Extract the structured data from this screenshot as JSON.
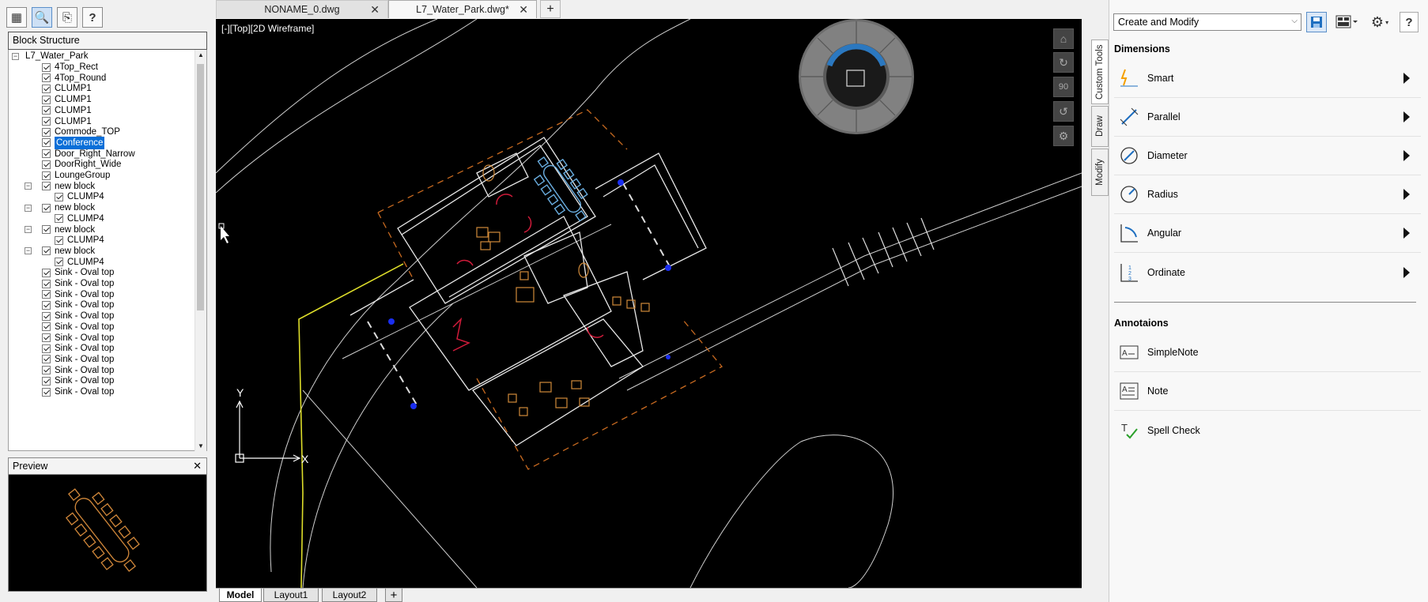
{
  "left_toolbar": {
    "icons": [
      "block-structure-icon",
      "preview-doc-icon",
      "export-icon",
      "help-icon"
    ]
  },
  "block_structure": {
    "title": "Block Structure",
    "root": "L7_Water_Park",
    "items": [
      {
        "label": "4Top_Rect"
      },
      {
        "label": "4Top_Round"
      },
      {
        "label": "CLUMP1"
      },
      {
        "label": "CLUMP1"
      },
      {
        "label": "CLUMP1"
      },
      {
        "label": "CLUMP1"
      },
      {
        "label": "Commode_TOP"
      },
      {
        "label": "Conference"
      },
      {
        "label": "Door_Right_Narrow"
      },
      {
        "label": "DoorRight_Wide"
      },
      {
        "label": "LoungeGroup"
      },
      {
        "label": "new block"
      },
      {
        "label": "CLUMP4"
      },
      {
        "label": "new block"
      },
      {
        "label": "CLUMP4"
      },
      {
        "label": "new block"
      },
      {
        "label": "CLUMP4"
      },
      {
        "label": "new block"
      },
      {
        "label": "CLUMP4"
      },
      {
        "label": "Sink - Oval top"
      },
      {
        "label": "Sink - Oval top"
      },
      {
        "label": "Sink - Oval top"
      },
      {
        "label": "Sink - Oval top"
      },
      {
        "label": "Sink - Oval top"
      },
      {
        "label": "Sink - Oval top"
      },
      {
        "label": "Sink - Oval top"
      },
      {
        "label": "Sink - Oval top"
      },
      {
        "label": "Sink - Oval top"
      },
      {
        "label": "Sink - Oval top"
      },
      {
        "label": "Sink - Oval top"
      },
      {
        "label": "Sink - Oval top"
      }
    ],
    "selected": "Conference"
  },
  "preview": {
    "title": "Preview",
    "close": "✕"
  },
  "doc_tabs": [
    {
      "label": "NONAME_0.dwg",
      "close": "✕",
      "active": false
    },
    {
      "label": "L7_Water_Park.dwg*",
      "close": "✕",
      "active": true
    }
  ],
  "add_tab": "+",
  "viewport_label": "[-][Top][2D Wireframe]",
  "nav_buttons": [
    "home-icon",
    "orbit-icon",
    "rotate-90-label",
    "pan-icon",
    "settings-icon"
  ],
  "nav_90": "90",
  "ucs": {
    "x": "X",
    "y": "Y"
  },
  "layout_tabs": [
    {
      "label": "Model"
    },
    {
      "label": "Layout1"
    },
    {
      "label": "Layout2"
    }
  ],
  "side_tabs": [
    {
      "label": "Custom Tools"
    },
    {
      "label": "Draw"
    },
    {
      "label": "Modify"
    }
  ],
  "right_panel": {
    "combo_value": "Create and Modify",
    "help": "?",
    "dimensions_title": "Dimensions",
    "dimensions": [
      {
        "label": "Smart",
        "icon": "smart-dimension-icon"
      },
      {
        "label": "Parallel",
        "icon": "parallel-dimension-icon"
      },
      {
        "label": "Diameter",
        "icon": "diameter-icon"
      },
      {
        "label": "Radius",
        "icon": "radius-icon"
      },
      {
        "label": "Angular",
        "icon": "angular-icon"
      },
      {
        "label": "Ordinate",
        "icon": "ordinate-icon"
      }
    ],
    "annotations_title": "Annotaions",
    "annotations": [
      {
        "label": "SimpleNote",
        "icon": "simple-note-icon"
      },
      {
        "label": "Note",
        "icon": "note-icon"
      },
      {
        "label": "Spell Check",
        "icon": "spell-check-icon"
      }
    ]
  }
}
